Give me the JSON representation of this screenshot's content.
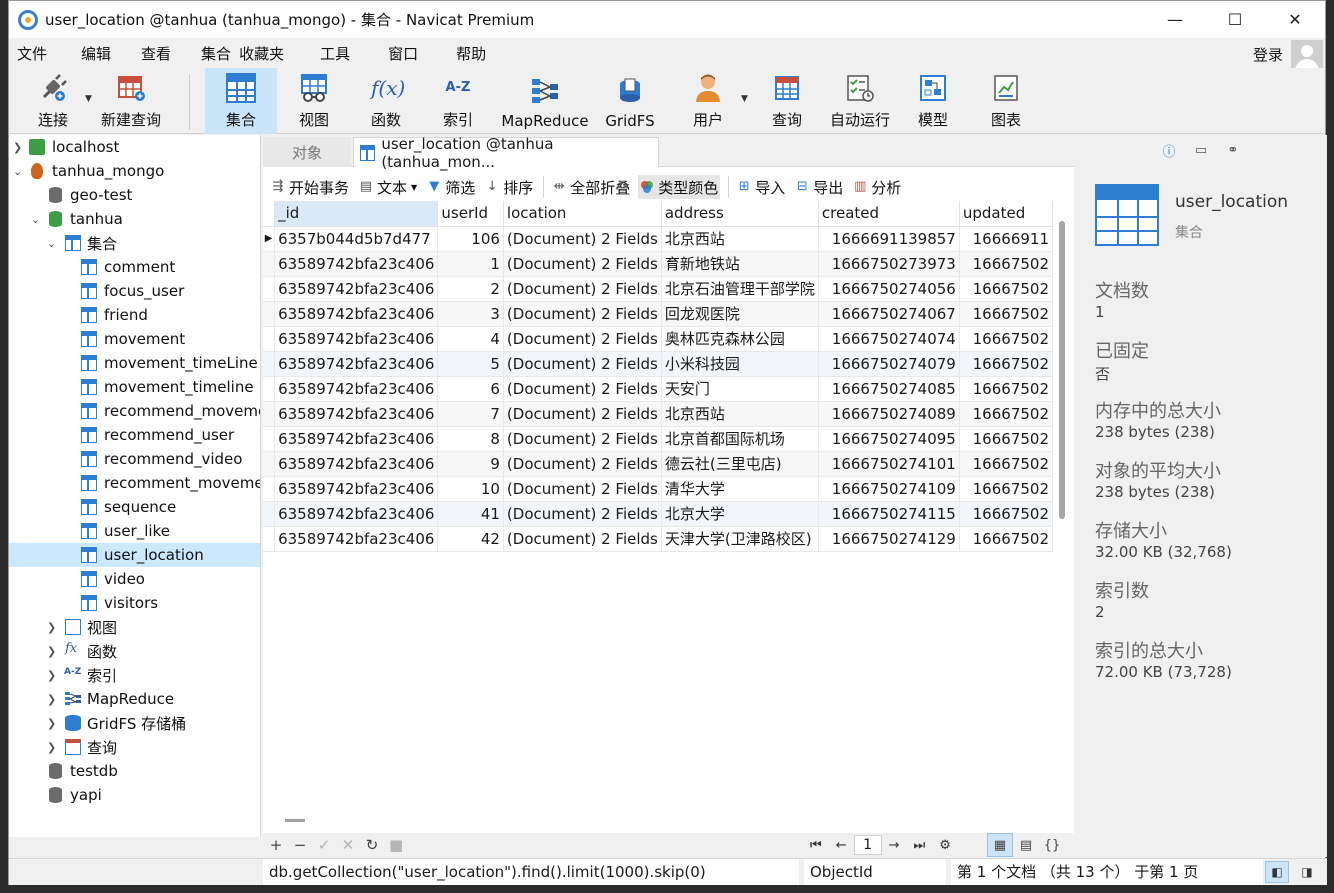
{
  "window": {
    "title": "user_location @tanhua (tanhua_mongo) - 集合 - Navicat Premium",
    "minimize": "—",
    "maximize": "☐",
    "close": "✕"
  },
  "menu": {
    "items": [
      "文件",
      "编辑",
      "查看",
      "集合",
      "收藏夹",
      "工具",
      "窗口",
      "帮助"
    ],
    "login": "登录"
  },
  "toolbar": {
    "connect": "连接",
    "new_query": "新建查询",
    "collection": "集合",
    "view": "视图",
    "function": "函数",
    "index": "索引",
    "mapreduce": "MapReduce",
    "gridfs": "GridFS",
    "user": "用户",
    "query": "查询",
    "automation": "自动运行",
    "model": "模型",
    "chart": "图表",
    "fx_glyph": "f(x)",
    "az_glyph": "A-Z"
  },
  "tree": {
    "localhost": "localhost",
    "tanhua_mongo": "tanhua_mongo",
    "geo_test": "geo-test",
    "tanhua": "tanhua",
    "collections_group": "集合",
    "collections": [
      "comment",
      "focus_user",
      "friend",
      "movement",
      "movement_timeLine",
      "movement_timeline",
      "recommend_moveme",
      "recommend_user",
      "recommend_video",
      "recomment_moveme",
      "sequence",
      "user_like",
      "user_location",
      "video",
      "visitors"
    ],
    "views_group": "视图",
    "functions_group": "函数",
    "indexes_group": "索引",
    "mapreduce_group": "MapReduce",
    "gridfs_group": "GridFS 存储桶",
    "queries_group": "查询",
    "testdb": "testdb",
    "yapi": "yapi"
  },
  "tabs": {
    "objects": "对象",
    "current": "user_location @tanhua (tanhua_mon..."
  },
  "actions": {
    "begin_tx": "开始事务",
    "text": "文本",
    "filter": "筛选",
    "sort": "排序",
    "collapse_all": "全部折叠",
    "type_color": "类型颜色",
    "import": "导入",
    "export": "导出",
    "analyze": "分析"
  },
  "grid": {
    "columns": [
      "_id",
      "userId",
      "location",
      "address",
      "created",
      "updated"
    ],
    "rows": [
      [
        "6357b044d5b7d477",
        "106",
        "(Document) 2 Fields",
        "北京西站",
        "1666691139857",
        "16666911"
      ],
      [
        "63589742bfa23c406",
        "1",
        "(Document) 2 Fields",
        "育新地铁站",
        "1666750273973",
        "16667502"
      ],
      [
        "63589742bfa23c406",
        "2",
        "(Document) 2 Fields",
        "北京石油管理干部学院",
        "1666750274056",
        "16667502"
      ],
      [
        "63589742bfa23c406",
        "3",
        "(Document) 2 Fields",
        "回龙观医院",
        "1666750274067",
        "16667502"
      ],
      [
        "63589742bfa23c406",
        "4",
        "(Document) 2 Fields",
        "奥林匹克森林公园",
        "1666750274074",
        "16667502"
      ],
      [
        "63589742bfa23c406",
        "5",
        "(Document) 2 Fields",
        "小米科技园",
        "1666750274079",
        "16667502"
      ],
      [
        "63589742bfa23c406",
        "6",
        "(Document) 2 Fields",
        "天安门",
        "1666750274085",
        "16667502"
      ],
      [
        "63589742bfa23c406",
        "7",
        "(Document) 2 Fields",
        "北京西站",
        "1666750274089",
        "16667502"
      ],
      [
        "63589742bfa23c406",
        "8",
        "(Document) 2 Fields",
        "北京首都国际机场",
        "1666750274095",
        "16667502"
      ],
      [
        "63589742bfa23c406",
        "9",
        "(Document) 2 Fields",
        "德云社(三里屯店)",
        "1666750274101",
        "16667502"
      ],
      [
        "63589742bfa23c406",
        "10",
        "(Document) 2 Fields",
        "清华大学",
        "1666750274109",
        "16667502"
      ],
      [
        "63589742bfa23c406",
        "41",
        "(Document) 2 Fields",
        "北京大学",
        "1666750274115",
        "16667502"
      ],
      [
        "63589742bfa23c406",
        "42",
        "(Document) 2 Fields",
        "天津大学(卫津路校区)",
        "1666750274129",
        "16667502"
      ]
    ]
  },
  "pager": {
    "page": "1"
  },
  "panel": {
    "name": "user_location",
    "type": "集合",
    "props": [
      {
        "key": "文档数",
        "value": "1"
      },
      {
        "key": "已固定",
        "value": "否"
      },
      {
        "key": "内存中的总大小",
        "value": "238 bytes (238)"
      },
      {
        "key": "对象的平均大小",
        "value": "238 bytes (238)"
      },
      {
        "key": "存储大小",
        "value": "32.00 KB (32,768)"
      },
      {
        "key": "索引数",
        "value": "2"
      },
      {
        "key": "索引的总大小",
        "value": "72.00 KB (73,728)"
      }
    ]
  },
  "status": {
    "query": "db.getCollection(\"user_location\").find().limit(1000).skip(0)",
    "type": "ObjectId",
    "page_info": "第 1 个文档 （共 13 个） 于第 1 页"
  },
  "colors": {
    "accent": "#2d7dd2",
    "selection": "#cce8ff",
    "active_tool": "#cce4f7"
  }
}
